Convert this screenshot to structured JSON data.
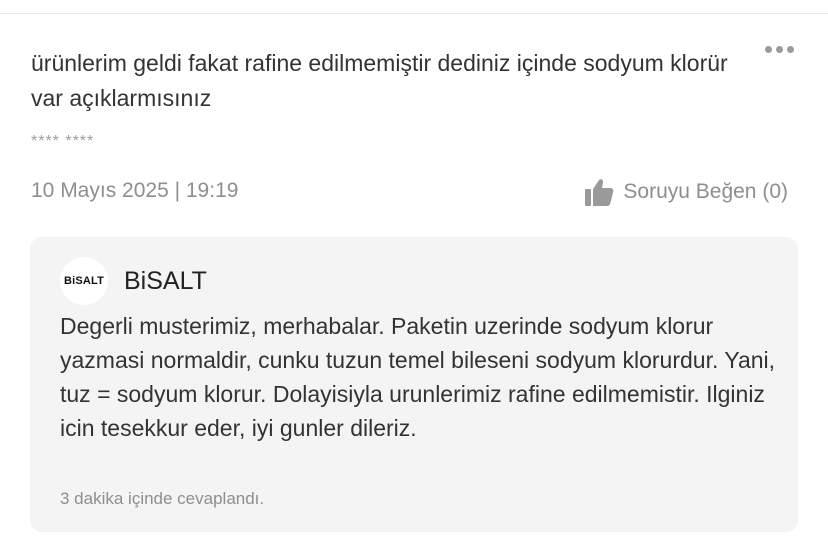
{
  "question": {
    "text": "ürünlerim geldi fakat rafine edilmemiştir dediniz içinde sodyum klorür var açıklarmısınız",
    "user": "**** ****",
    "date": "10 Mayıs 2025 | 19:19",
    "like_label": "Soruyu Beğen (0)"
  },
  "answer": {
    "seller_logo_text": "BiSALT",
    "seller_name": "BiSALT",
    "text": "Degerli musterimiz, merhabalar. Paketin uzerinde sodyum klorur yazmasi normaldir, cunku tuzun temel bileseni sodyum klorurdur. Yani, tuz = sodyum klorur. Dolayisiyla urunlerimiz rafine edilmemistir. Ilginiz icin tesekkur eder, iyi gunler dileriz.",
    "answered_time": "3 dakika içinde cevaplandı."
  },
  "icons": {
    "more": "more-dots-icon",
    "like": "thumbs-up-icon"
  },
  "colors": {
    "card_background": "#f4f4f4",
    "muted_text": "#8e8e8e",
    "icon_gray": "#9a9a9a"
  }
}
